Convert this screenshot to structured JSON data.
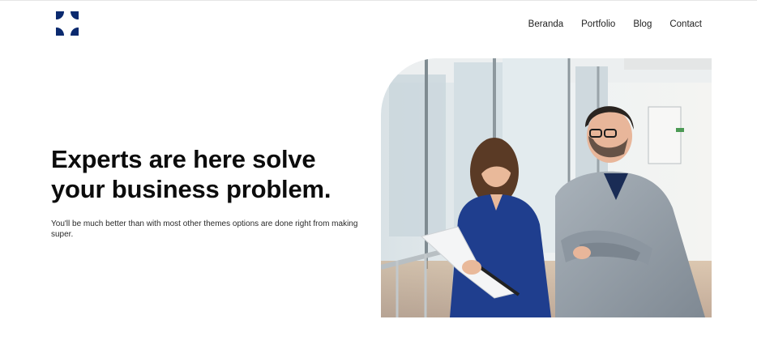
{
  "nav": {
    "items": [
      {
        "label": "Beranda"
      },
      {
        "label": "Portfolio"
      },
      {
        "label": "Blog"
      },
      {
        "label": "Contact"
      }
    ]
  },
  "hero": {
    "title": "Experts are here solve your business problem.",
    "text": "You'll be much better than with most other themes options are done right from making super."
  },
  "colors": {
    "brand": "#0b2a6f",
    "heading": "#0c0c0c"
  },
  "icons": {
    "logo": "four-arc-logo-icon"
  }
}
